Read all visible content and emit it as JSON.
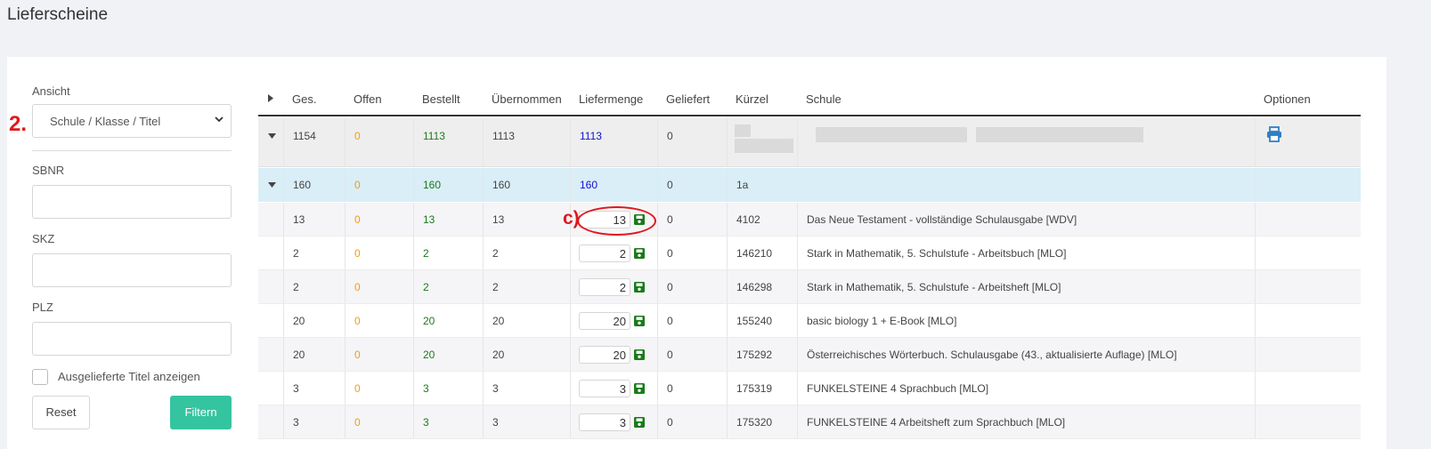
{
  "page": {
    "title": "Lieferscheine"
  },
  "sidebar": {
    "ansicht_label": "Ansicht",
    "ansicht_value": "Schule / Klasse / Titel",
    "annotation": "2.",
    "sbnr_label": "SBNR",
    "sbnr_value": "",
    "skz_label": "SKZ",
    "skz_value": "",
    "plz_label": "PLZ",
    "plz_value": "",
    "checkbox_label": "Ausgelieferte Titel anzeigen",
    "checkbox_checked": false,
    "reset_label": "Reset",
    "filter_label": "Filtern"
  },
  "table": {
    "headers": [
      "Ges.",
      "Offen",
      "Bestellt",
      "Übernommen",
      "Liefermenge",
      "Geliefert",
      "Kürzel",
      "Schule",
      "Optionen"
    ],
    "school_row": {
      "ges": "1154",
      "offen": "0",
      "bestellt": "1113",
      "uebernommen": "1113",
      "liefermenge": "1113",
      "geliefert": "0"
    },
    "class_row": {
      "ges": "160",
      "offen": "0",
      "bestellt": "160",
      "uebernommen": "160",
      "liefermenge": "160",
      "geliefert": "0",
      "kuerzel": "1a"
    },
    "rows": [
      {
        "ges": "13",
        "offen": "0",
        "bestellt": "13",
        "uebernommen": "13",
        "liefermenge": "13",
        "geliefert": "0",
        "kuerzel": "4102",
        "titel": "Das Neue Testament - vollständige Schulausgabe [WDV]"
      },
      {
        "ges": "2",
        "offen": "0",
        "bestellt": "2",
        "uebernommen": "2",
        "liefermenge": "2",
        "geliefert": "0",
        "kuerzel": "146210",
        "titel": "Stark in Mathematik, 5. Schulstufe - Arbeitsbuch [MLO]"
      },
      {
        "ges": "2",
        "offen": "0",
        "bestellt": "2",
        "uebernommen": "2",
        "liefermenge": "2",
        "geliefert": "0",
        "kuerzel": "146298",
        "titel": "Stark in Mathematik, 5. Schulstufe - Arbeitsheft [MLO]"
      },
      {
        "ges": "20",
        "offen": "0",
        "bestellt": "20",
        "uebernommen": "20",
        "liefermenge": "20",
        "geliefert": "0",
        "kuerzel": "155240",
        "titel": "basic biology 1 + E-Book [MLO]"
      },
      {
        "ges": "20",
        "offen": "0",
        "bestellt": "20",
        "uebernommen": "20",
        "liefermenge": "20",
        "geliefert": "0",
        "kuerzel": "175292",
        "titel": "Österreichisches Wörterbuch. Schulausgabe (43., aktualisierte Auflage) [MLO]"
      },
      {
        "ges": "3",
        "offen": "0",
        "bestellt": "3",
        "uebernommen": "3",
        "liefermenge": "3",
        "geliefert": "0",
        "kuerzel": "175319",
        "titel": "FUNKELSTEINE 4 Sprachbuch [MLO]"
      },
      {
        "ges": "3",
        "offen": "0",
        "bestellt": "3",
        "uebernommen": "3",
        "liefermenge": "3",
        "geliefert": "0",
        "kuerzel": "175320",
        "titel": "FUNKELSTEINE 4 Arbeitsheft zum Sprachbuch [MLO]"
      }
    ],
    "annotation": "c)"
  },
  "colors": {
    "accent": "#35c4a0",
    "annotation": "#e0181d",
    "class_row_bg": "#d9eef7",
    "school_row_bg": "#eeeeee",
    "print_icon": "#2f7fc6",
    "save_icon": "#1b7a1b"
  }
}
